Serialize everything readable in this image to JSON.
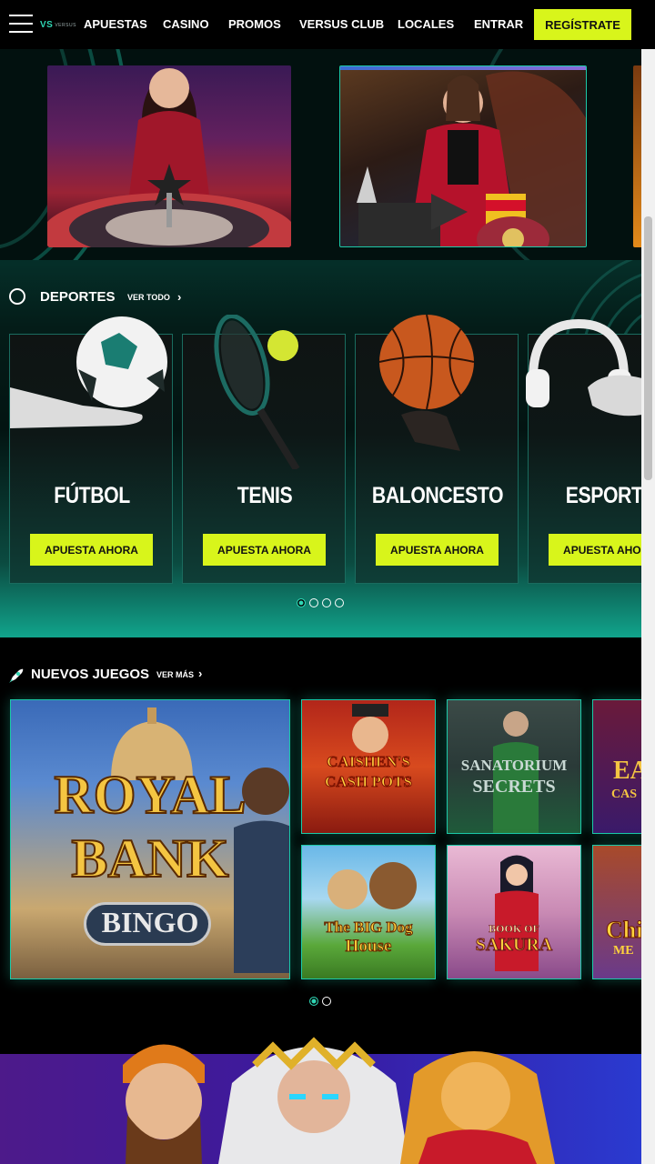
{
  "nav": {
    "logo_mark": "VS",
    "logo_text": "VERSUS",
    "links": [
      "APUESTAS",
      "CASINO",
      "PROMOS",
      "VERSUS CLUB",
      "LOCALES"
    ],
    "login": "ENTRAR",
    "register": "REGÍSTRATE"
  },
  "sports": {
    "title": "DEPORTES",
    "more": "VER TODO",
    "cards": [
      {
        "label": "FÚTBOL",
        "button": "APUESTA AHORA"
      },
      {
        "label": "TENIS",
        "button": "APUESTA AHORA"
      },
      {
        "label": "BALONCESTO",
        "button": "APUESTA AHORA"
      },
      {
        "label": "ESPORTS",
        "button": "APUESTA AHORA"
      }
    ],
    "pagination": {
      "total": 4,
      "active": 1
    }
  },
  "games": {
    "title": "NUEVOS JUEGOS",
    "more": "VER MÁS",
    "featured": {
      "line1": "ROYAL",
      "line2": "BANK",
      "line3": "BINGO"
    },
    "tiles": [
      {
        "line1": "CAISHEN'S",
        "line2": "CASH POTS"
      },
      {
        "line1": "SANATORIUM",
        "line2": "SECRETS"
      },
      {
        "line1": "EA",
        "line2": "CAS"
      },
      {
        "line1": "The BIG Dog",
        "line2": "House"
      },
      {
        "line1": "BOOK OF",
        "line2": "SAKURA"
      },
      {
        "line1": "Chi",
        "line2": "ME"
      }
    ],
    "pagination": {
      "total": 2,
      "active": 1
    }
  },
  "colors": {
    "accent": "#d8f51b",
    "teal": "#2fd6b4"
  }
}
